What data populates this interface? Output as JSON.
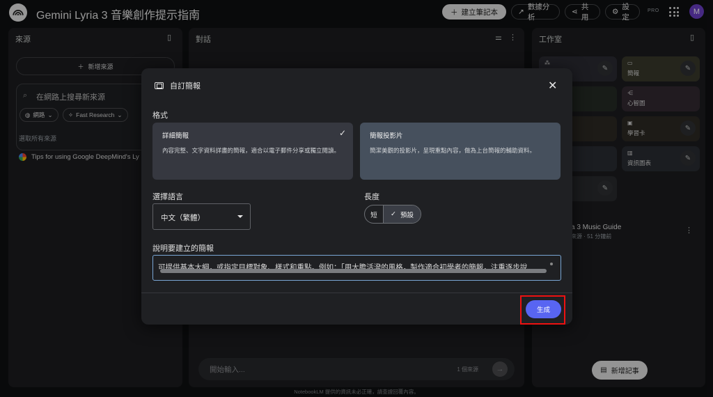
{
  "header": {
    "title": "Gemini Lyria 3 音樂創作提示指南",
    "create_label": "建立筆記本",
    "analytics_label": "數據分析",
    "share_label": "共用",
    "settings_label": "設定",
    "pro_badge": "PRO",
    "avatar_letter": "M"
  },
  "sources": {
    "title": "來源",
    "add_label": "新增來源",
    "search_placeholder": "在網路上搜尋新來源",
    "chip_web": "網路",
    "chip_research": "Fast Research",
    "select_all": "選取所有來源",
    "items": [
      {
        "label": "Tips for using Google DeepMind's Ly"
      }
    ]
  },
  "chat": {
    "title": "對話",
    "input_placeholder": "開始輸入...",
    "source_count": "1 個來源"
  },
  "studio": {
    "title": "工作室",
    "cards": [
      {
        "label": "",
        "color": "#2b2c33"
      },
      {
        "label": "簡報",
        "color": "#3a3a2c"
      },
      {
        "label": "",
        "color": "#262b26"
      },
      {
        "label": "心智圖",
        "color": "#342a32"
      },
      {
        "label": "",
        "color": "#2d2a24"
      },
      {
        "label": "學習卡",
        "color": "#2d2a24"
      },
      {
        "label": "",
        "color": "#2a2d33"
      },
      {
        "label": "資訊圖表",
        "color": "#2a2d33"
      },
      {
        "label": "",
        "color": "#2a2b2e"
      }
    ],
    "note_title": "a 3 Music Guide",
    "note_sub": "來源 · 51 分鐘前",
    "add_note_label": "新增記事"
  },
  "footer": "NotebookLM 提供的資訊未必正確，請查證回覆內容。",
  "modal": {
    "title": "自訂簡報",
    "format_label": "格式",
    "formats": [
      {
        "title": "詳細簡報",
        "desc": "內容完整、文字資料詳盡的簡報，適合以電子郵件分享或獨立閱讀。"
      },
      {
        "title": "簡報投影片",
        "desc": "簡潔美觀的投影片，呈現重點內容，做為上台簡報的輔助資料。"
      }
    ],
    "language_label": "選擇語言",
    "language_value": "中文（繁體）",
    "length_label": "長度",
    "length_short": "短",
    "length_default": "預設",
    "prompt_label": "說明要建立的簡報",
    "prompt_text": "可提供基本大綱，或指定目標對象、樣式和重點。例如：「用大膽活潑的風格，製作適合初學者的簡報，注重逐步說",
    "generate_label": "生成"
  }
}
